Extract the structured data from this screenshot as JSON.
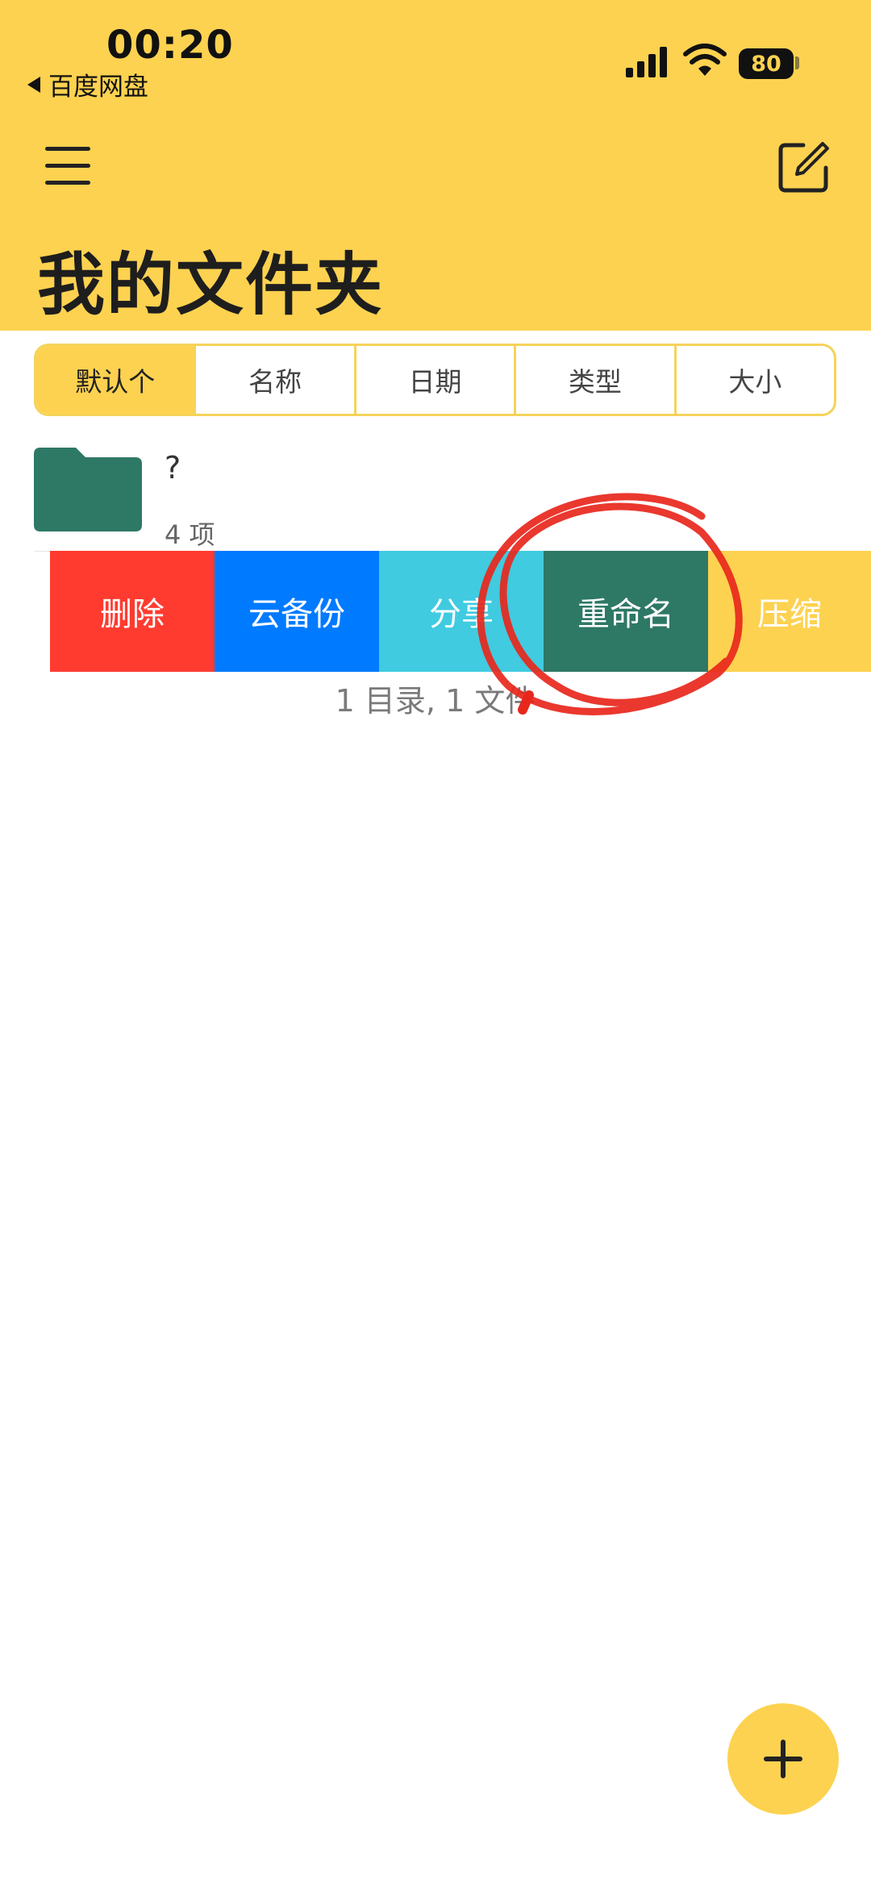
{
  "status_bar": {
    "time": "00:20",
    "back_app": "百度网盘",
    "battery": "80"
  },
  "header": {
    "title": "我的文件夹"
  },
  "sort_tabs": [
    {
      "label": "默认个"
    },
    {
      "label": "名称"
    },
    {
      "label": "日期"
    },
    {
      "label": "类型"
    },
    {
      "label": "大小"
    }
  ],
  "folder": {
    "name": "?",
    "count": "4 项"
  },
  "swipe_actions": {
    "delete": "删除",
    "backup": "云备份",
    "share": "分享",
    "rename": "重命名",
    "zip": "压缩"
  },
  "summary": "1 目录, 1 文件",
  "colors": {
    "accent": "#FDD250",
    "delete": "#FF3B30",
    "backup": "#007AFF",
    "share": "#40CBE0",
    "rename": "#2E7866",
    "folder": "#2E7866",
    "annotation": "#E8271C"
  },
  "icons": {
    "menu": "hamburger-menu-icon",
    "edit": "edit-square-icon",
    "folder": "folder-icon",
    "add": "plus-icon"
  }
}
